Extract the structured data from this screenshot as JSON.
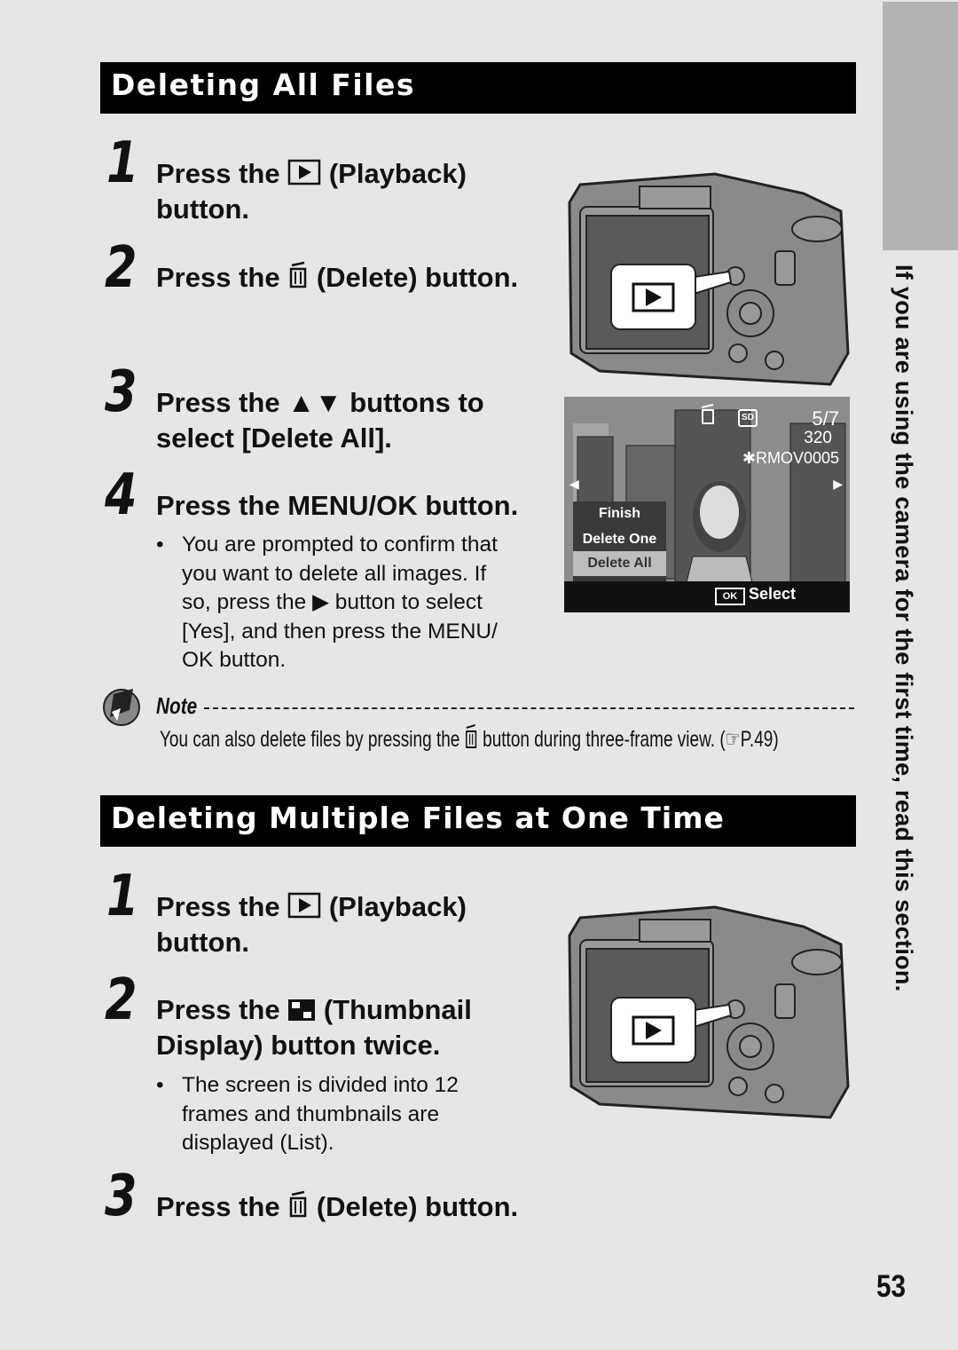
{
  "section1": {
    "title": "Deleting All Files",
    "steps": [
      {
        "num": "1",
        "pre": "Press the",
        "icon": "playback-icon",
        "post": "(Playback)",
        "line2": "button."
      },
      {
        "num": "2",
        "pre": "Press the",
        "icon": "delete-icon",
        "post": "(Delete) button."
      },
      {
        "num": "3",
        "pre": "Press the",
        "icon": "up-down-icon",
        "icon_glyph": "▲▼",
        "post": "buttons to",
        "line2": "select [Delete All]."
      },
      {
        "num": "4",
        "text": "Press the MENU/OK button."
      }
    ],
    "bullet": {
      "l1": "You are prompted to confirm that",
      "l2": "you want to delete all images. If",
      "l3_pre": "so, press the",
      "l3_glyph": "▶",
      "l3_post": "button to select",
      "l4": "[Yes], and then press the MENU/",
      "l5": "OK button."
    }
  },
  "lcd": {
    "frame": "5/7",
    "size": "320",
    "filename": "RMOV0005",
    "menu": [
      "Finish",
      "Delete One",
      "Delete All"
    ],
    "selected": "Delete All",
    "ok_label": "OK",
    "select_label": "Select",
    "card_label": "SD"
  },
  "callout": {
    "glyph": "▶"
  },
  "note": {
    "label": "Note",
    "text_pre": "You can also delete files by pressing the",
    "text_post": "button during three-frame view. (",
    "ref": "P.49",
    "close": ")"
  },
  "section2": {
    "title": "Deleting Multiple Files at One Time",
    "steps": [
      {
        "num": "1",
        "pre": "Press the",
        "post": "(Playback)",
        "line2": "button."
      },
      {
        "num": "2",
        "pre": "Press the",
        "post": "(Thumbnail",
        "line2": "Display) button twice."
      },
      {
        "num": "3",
        "pre": "Press the",
        "post": "(Delete) button."
      }
    ],
    "bullet": {
      "l1": "The screen is divided into 12",
      "l2": "frames and thumbnails are",
      "l3": "displayed (List)."
    }
  },
  "side_text": "If you are using the camera for the first time, read this section.",
  "page_number": "53",
  "bullet_char": "•"
}
